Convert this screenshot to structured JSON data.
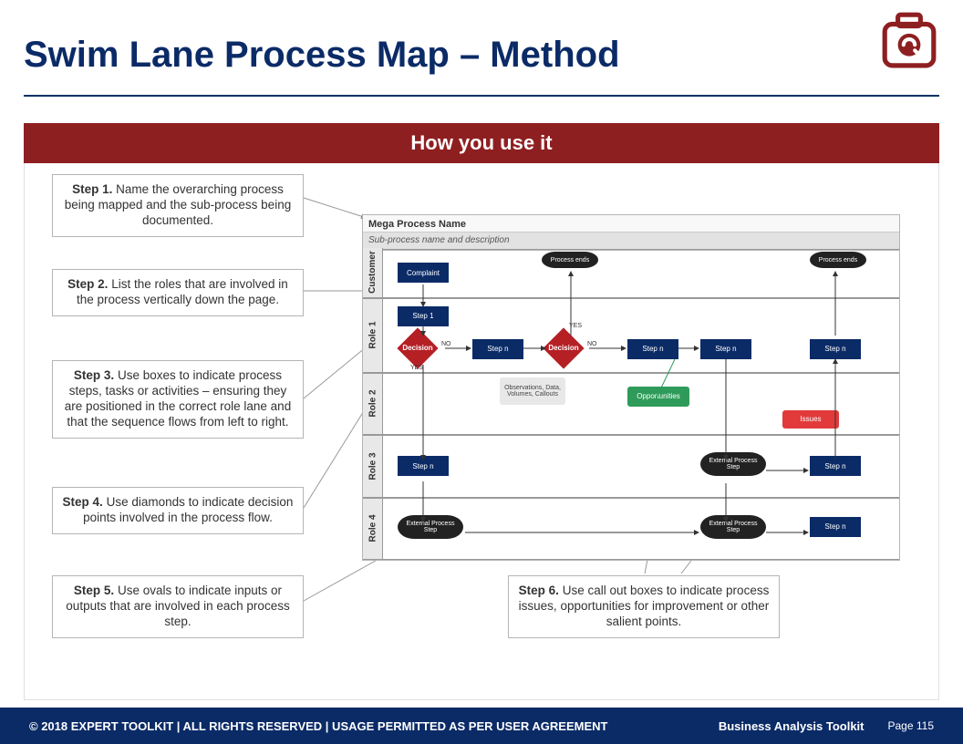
{
  "title": "Swim Lane Process Map – Method",
  "banner": "How you use it",
  "steps": {
    "s1": "Name the overarching process being mapped and the sub-process being documented.",
    "s2": "List the roles that are involved in the process vertically down the page.",
    "s3": "Use boxes to indicate process steps, tasks or activities – ensuring they are positioned in the correct role lane and that the sequence flows from left to right.",
    "s4": "Use diamonds to indicate decision points involved in the process flow.",
    "s5": "Use ovals to indicate inputs or outputs that are involved in each process step.",
    "s6": "Use call out boxes to indicate process issues, opportunities for improvement or other salient points."
  },
  "step_labels": {
    "s1": "Step 1.",
    "s2": "Step 2.",
    "s3": "Step 3.",
    "s4": "Step 4.",
    "s5": "Step 5.",
    "s6": "Step 6."
  },
  "diagram": {
    "title": "Mega Process Name",
    "subtitle": "Sub-process name and description",
    "lanes": [
      "Customer",
      "Role 1",
      "Role 2",
      "Role 3",
      "Role 4"
    ],
    "labels": {
      "complaint": "Complaint",
      "step1": "Step 1",
      "stepn": "Step n",
      "decision": "Decision",
      "process_ends": "Process ends",
      "observations": "Observations, Data, Volumes, Callouts",
      "opportunities": "Opportunities",
      "issues": "Issues",
      "external": "External Process Step",
      "yes": "YES",
      "no": "NO"
    }
  },
  "footer": {
    "copyright": "© 2018 EXPERT TOOLKIT | ALL RIGHTS RESERVED | USAGE PERMITTED AS PER USER AGREEMENT",
    "brand": "Business Analysis Toolkit",
    "page": "Page 115"
  }
}
